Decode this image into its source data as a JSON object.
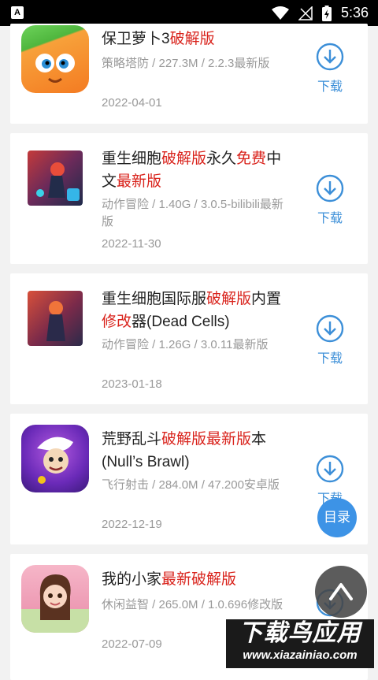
{
  "status_bar": {
    "left_badge": "A",
    "time": "5:36"
  },
  "apps": [
    {
      "title_parts": [
        {
          "t": "保卫萝卜3",
          "red": false
        },
        {
          "t": "破解版",
          "red": true
        }
      ],
      "meta": "策略塔防 / 227.3M / 2.2.3最新版",
      "date": "2022-04-01",
      "download_label": "下载",
      "icon": "carrot-game-icon"
    },
    {
      "title_parts": [
        {
          "t": "重生细胞",
          "red": false
        },
        {
          "t": "破解版",
          "red": true
        },
        {
          "t": "永久",
          "red": false
        },
        {
          "t": "免费",
          "red": true
        },
        {
          "t": "中文",
          "red": false
        },
        {
          "t": "最新版",
          "red": true
        }
      ],
      "meta": "动作冒险 / 1.40G / 3.0.5-bilibili最新版",
      "date": "2022-11-30",
      "download_label": "下载",
      "icon": "dead-cells-bilibili-icon"
    },
    {
      "title_parts": [
        {
          "t": "重生细胞国际服",
          "red": false
        },
        {
          "t": "破解版",
          "red": true
        },
        {
          "t": "内置",
          "red": false
        },
        {
          "t": "修改",
          "red": true
        },
        {
          "t": "器(Dead Cells)",
          "red": false
        }
      ],
      "meta": "动作冒险 / 1.26G / 3.0.11最新版",
      "date": "2023-01-18",
      "download_label": "下载",
      "icon": "dead-cells-icon"
    },
    {
      "title_parts": [
        {
          "t": "荒野乱斗",
          "red": false
        },
        {
          "t": "破解版最新版",
          "red": true
        },
        {
          "t": "本(Null’s Brawl)",
          "red": false
        }
      ],
      "meta": "飞行射击 / 284.0M / 47.200安卓版",
      "date": "2022-12-19",
      "download_label": "下载",
      "icon": "brawl-stars-icon"
    },
    {
      "title_parts": [
        {
          "t": "我的小家",
          "red": false
        },
        {
          "t": "最新破解版",
          "red": true
        }
      ],
      "meta": "休闲益智 / 265.0M / 1.0.696修改版",
      "date": "2022-07-09",
      "download_label": "下载",
      "icon": "my-home-girl-icon"
    }
  ],
  "toc_button": "目录",
  "back_to_top_icon": "chevron-up-icon",
  "watermark": {
    "brand": "下载鸟应用",
    "url": "www.xiazainiao.com"
  },
  "colors": {
    "accent_blue": "#3c8fd8",
    "highlight_red": "#d9231c",
    "meta_gray": "#999999",
    "page_bg": "#f2f2f2"
  }
}
